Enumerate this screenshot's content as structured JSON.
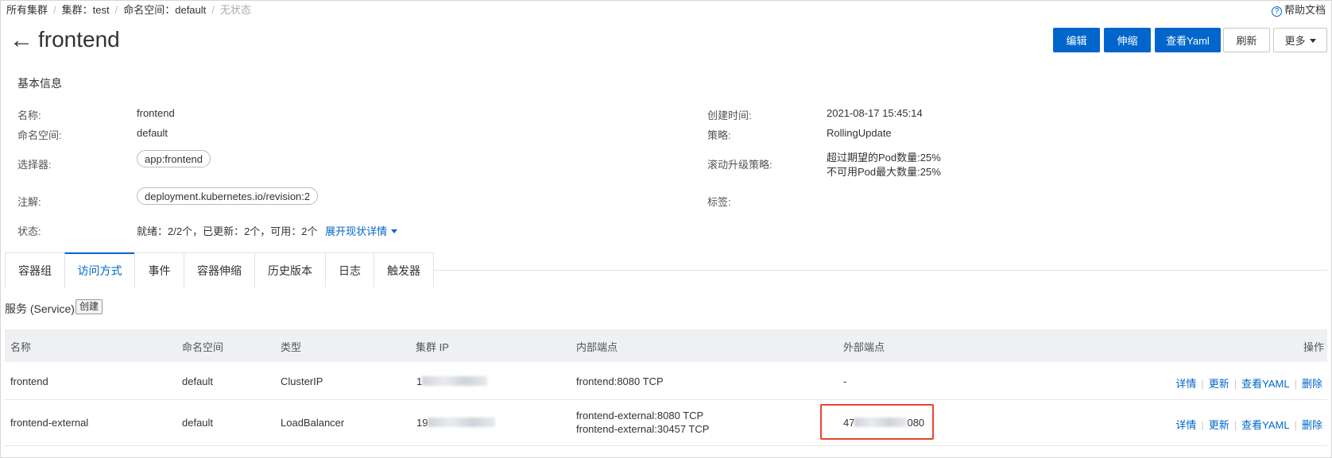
{
  "breadcrumb": {
    "all_clusters": "所有集群",
    "cluster": "集群：test",
    "namespace": "命名空间：default",
    "state": "无状态"
  },
  "help": {
    "label": "帮助文档"
  },
  "header": {
    "back_arrow": "←",
    "title": "frontend",
    "buttons": {
      "edit": "编辑",
      "scale": "伸缩",
      "view_yaml": "查看Yaml",
      "refresh": "刷新",
      "more": "更多"
    }
  },
  "basic_info": {
    "section_title": "基本信息",
    "name_label": "名称:",
    "name_value": "frontend",
    "namespace_label": "命名空间:",
    "namespace_value": "default",
    "selector_label": "选择器:",
    "selector_value": "app:frontend",
    "annotation_label": "注解:",
    "annotation_value": "deployment.kubernetes.io/revision:2",
    "status_label": "状态:",
    "status_value": "就绪：2/2个，已更新：2个，可用：2个",
    "status_expand": "展开现状详情",
    "created_label": "创建时间:",
    "created_value": "2021-08-17 15:45:14",
    "strategy_label": "策略:",
    "strategy_value": "RollingUpdate",
    "rolling_label": "滚动升级策略:",
    "rolling_line1": "超过期望的Pod数量:25%",
    "rolling_line2": "不可用Pod最大数量:25%",
    "labels_label": "标签:"
  },
  "tabs": [
    {
      "label": "容器组"
    },
    {
      "label": "访问方式",
      "active": true
    },
    {
      "label": "事件"
    },
    {
      "label": "容器伸缩"
    },
    {
      "label": "历史版本"
    },
    {
      "label": "日志"
    },
    {
      "label": "触发器"
    }
  ],
  "service": {
    "title": "服务 (Service)",
    "create_button": "创建",
    "columns": [
      "名称",
      "命名空间",
      "类型",
      "集群 IP",
      "内部端点",
      "外部端点",
      "操作"
    ],
    "rows": [
      {
        "name": "frontend",
        "namespace": "default",
        "type": "ClusterIP",
        "cluster_ip_prefix": "1",
        "internal_endpoint_1": "frontend:8080 TCP",
        "internal_endpoint_2": "",
        "external_endpoint": "-"
      },
      {
        "name": "frontend-external",
        "namespace": "default",
        "type": "LoadBalancer",
        "cluster_ip_prefix": "19",
        "internal_endpoint_1": "frontend-external:8080 TCP",
        "internal_endpoint_2": "frontend-external:30457 TCP",
        "external_endpoint_prefix": "47",
        "external_endpoint_suffix": "080"
      }
    ],
    "actions": {
      "details": "详情",
      "update": "更新",
      "view_yaml": "查看YAML",
      "delete": "删除"
    }
  },
  "colors": {
    "primary": "#0066cc",
    "highlight": "#e8452c",
    "header_bg": "#eef0f3"
  }
}
